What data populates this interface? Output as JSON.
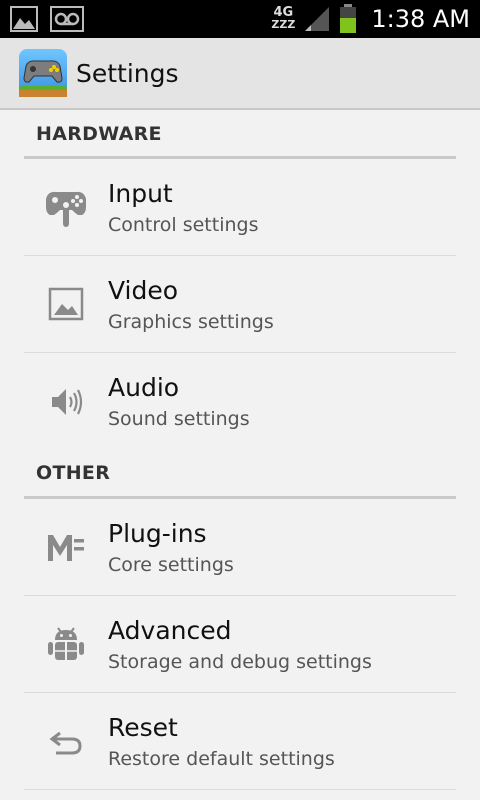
{
  "status_bar": {
    "network_type": "4G",
    "network_sub": "ZZZ",
    "time": "1:38 AM",
    "battery_color": "#7fc31c"
  },
  "action_bar": {
    "title": "Settings"
  },
  "sections": [
    {
      "header": "HARDWARE",
      "items": [
        {
          "title": "Input",
          "summary": "Control settings",
          "icon": "gamepad-icon"
        },
        {
          "title": "Video",
          "summary": "Graphics settings",
          "icon": "image-icon"
        },
        {
          "title": "Audio",
          "summary": "Sound settings",
          "icon": "speaker-icon"
        }
      ]
    },
    {
      "header": "OTHER",
      "items": [
        {
          "title": "Plug-ins",
          "summary": "Core settings",
          "icon": "plugin-icon"
        },
        {
          "title": "Advanced",
          "summary": "Storage and debug settings",
          "icon": "android-icon"
        },
        {
          "title": "Reset",
          "summary": "Restore default settings",
          "icon": "undo-icon"
        }
      ]
    }
  ]
}
